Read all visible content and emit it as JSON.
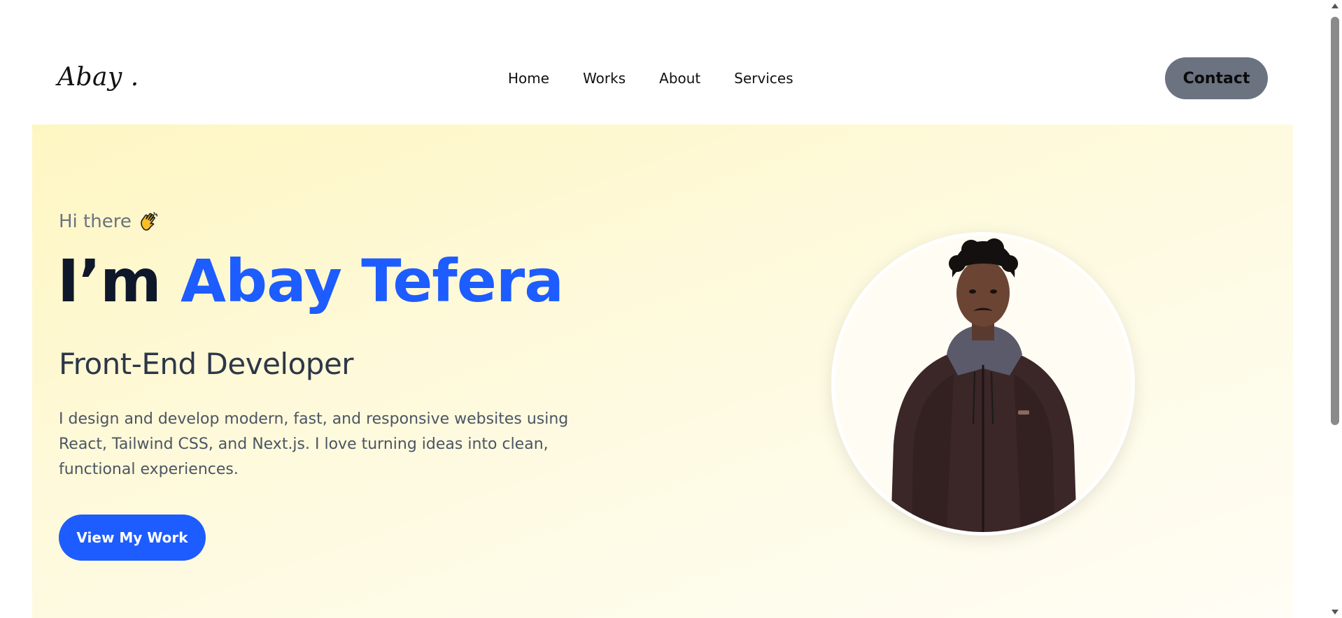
{
  "header": {
    "logo": "Abay .",
    "nav": [
      {
        "label": "Home"
      },
      {
        "label": "Works"
      },
      {
        "label": "About"
      },
      {
        "label": "Services"
      }
    ],
    "contact_label": "Contact"
  },
  "hero": {
    "greeting": "Hi there",
    "greeting_icon": "waving-hand-icon",
    "headline_prefix": "I’m",
    "headline_name": "Abay Tefera",
    "role": "Front-End Developer",
    "bio": "I design and develop modern, fast, and responsive websites using React, Tailwind CSS, and Next.js. I love turning ideas into clean, functional experiences.",
    "cta_label": "View My Work"
  },
  "colors": {
    "accent": "#1d5cff",
    "contact_button": "#6b7280",
    "hero_background": "#fef6c2"
  }
}
